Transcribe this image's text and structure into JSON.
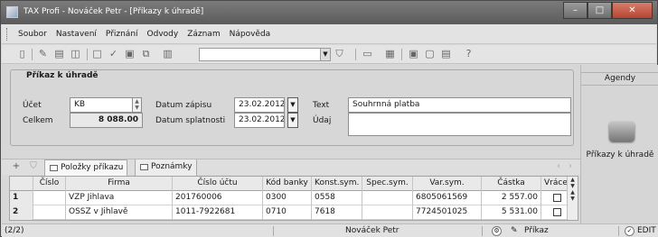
{
  "window": {
    "title": "TAX Profi - Nováček Petr - [Příkazy k úhradě]",
    "minimize": "–",
    "maximize": "□",
    "close": "✕"
  },
  "menu": [
    "Soubor",
    "Nastavení",
    "Přiznání",
    "Odvody",
    "Záznam",
    "Nápověda"
  ],
  "toolbar": {
    "icons": [
      "document-icon",
      "edit-icon",
      "print-icon",
      "preview-icon",
      "new-icon",
      "approve-icon",
      "save-icon",
      "copy-icon",
      "paste-icon",
      "filter-icon",
      "folder-icon",
      "calendar-icon",
      "layout-icon",
      "window-icon",
      "table-icon",
      "help-icon"
    ],
    "search_value": ""
  },
  "form": {
    "group_title": "Příkaz k úhradě",
    "account_label": "Účet",
    "account_value": "KB",
    "total_label": "Celkem",
    "total_value": "8 088.00",
    "date_entry_label": "Datum zápisu",
    "date_entry_value": "23.02.2012",
    "date_due_label": "Datum splatnosti",
    "date_due_value": "23.02.2012",
    "text_label": "Text",
    "text_value": "Souhrnná platba",
    "data_label": "Údaj",
    "data_value": ""
  },
  "sidebar": {
    "title": "Agendy",
    "item_label": "Příkazy k úhradě"
  },
  "tabs": [
    {
      "label": "Položky příkazu",
      "active": true
    },
    {
      "label": "Poznámky",
      "active": false
    }
  ],
  "table": {
    "columns": [
      "Číslo",
      "Firma",
      "Číslo účtu",
      "Kód banky",
      "Konst.sym.",
      "Spec.sym.",
      "Var.sym.",
      "Částka",
      "Vráceno"
    ],
    "rows": [
      {
        "row_no": "1",
        "number": "",
        "firm": "VZP Jihlava",
        "account": "201760006",
        "bank_code": "0300",
        "const_sym": "0558",
        "spec_sym": "",
        "var_sym": "6805061569",
        "amount": "2 557.00",
        "returned": false
      },
      {
        "row_no": "2",
        "number": "",
        "firm": "OSSZ v Jihlavě",
        "account": "1011-7922681",
        "bank_code": "0710",
        "const_sym": "7618",
        "spec_sym": "",
        "var_sym": "7724501025",
        "amount": "5 531.00",
        "returned": false
      }
    ]
  },
  "status": {
    "record_position": "(2/2)",
    "user": "Nováček Petr",
    "mode": "Příkaz",
    "edit": "EDIT"
  }
}
